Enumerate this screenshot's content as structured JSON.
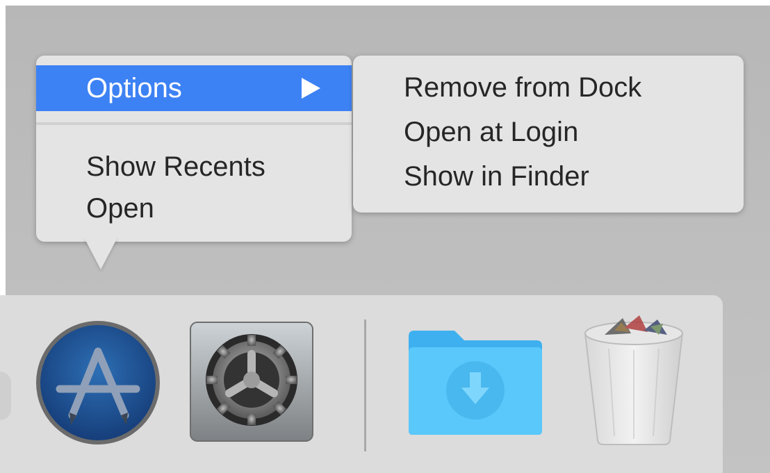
{
  "context_menu": {
    "selected_item": {
      "label": "Options",
      "icon": "submenu-arrow-icon"
    },
    "items": [
      {
        "label": "Show Recents"
      },
      {
        "label": "Open"
      }
    ]
  },
  "submenu": {
    "items": [
      {
        "label": "Remove from Dock"
      },
      {
        "label": "Open at Login"
      },
      {
        "label": "Show in Finder"
      }
    ]
  },
  "dock": {
    "apps": [
      {
        "name": "App Store",
        "icon": "app-store-icon"
      },
      {
        "name": "System Preferences",
        "icon": "system-preferences-icon"
      }
    ],
    "stacks": [
      {
        "name": "Downloads",
        "icon": "downloads-folder-icon"
      },
      {
        "name": "Trash",
        "icon": "trash-icon"
      }
    ]
  },
  "colors": {
    "menu_background": "#e4e4e4",
    "selection": "#3d82f4",
    "menu_text": "#262626",
    "folder_blue": "#5ac8fa",
    "dock_background": "#dcdcdc"
  }
}
